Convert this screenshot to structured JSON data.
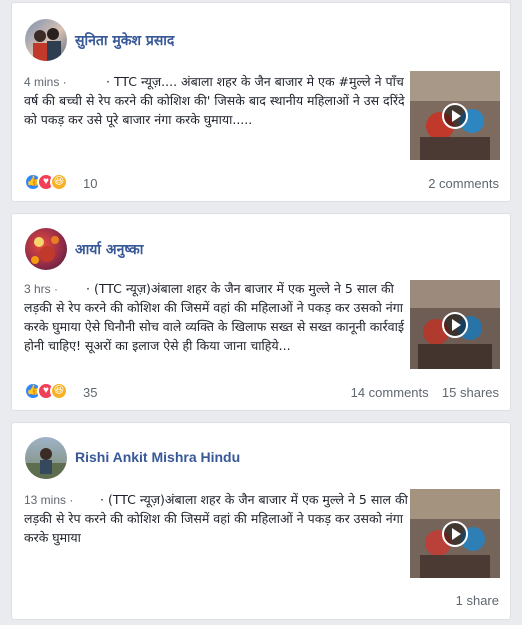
{
  "posts": [
    {
      "author": "सुनिता मुकेश प्रसाद",
      "time": "4 mins ·",
      "text": "· TTC न्यूज़.... अंबाला शहर के जैन बाजार मे एक #मुल्ले ने पाँच वर्ष की बच्ची से रेप करने की कोशिश की' जिसके बाद स्थानीय महिलाओं ने उस दरिंदे को पकड़ कर उसे पूरे बाजार नंगा करके घुमाया.....",
      "reactions_count": "10",
      "comments": "2 comments",
      "shares": ""
    },
    {
      "author": "आर्या अनुष्का",
      "time": "3 hrs ·",
      "text": "· (TTC न्यूज़)अंबाला शहर के जैन बाजार में एक मुल्ले ने 5 साल की लड़की से रेप करने की कोशिश की जिसमें वहां की महिलाओं ने पकड़ कर उसको नंगा करके घुमाया ऐसे घिनौनी सोच वाले व्यक्ति के खिलाफ सख्त से सख्त कानूनी कार्रवाई होनी चाहिए! सूअरों का इलाज ऐसे ही किया जाना चाहिये...",
      "reactions_count": "35",
      "comments": "14 comments",
      "shares": "15 shares"
    },
    {
      "author": "Rishi Ankit Mishra Hindu",
      "time": "13 mins ·",
      "text": "· (TTC न्यूज़)अंबाला शहर के जैन बाजार में एक मुल्ले ने 5 साल की लड़की से रेप करने की कोशिश की जिसमें वहां की महिलाओं ने पकड़ कर उसको नंगा करके घुमाया",
      "reactions_count": "",
      "comments": "",
      "shares": "1 share"
    }
  ],
  "colors": {
    "author": "#385898",
    "like": "#2d88ff",
    "love": "#f33e58",
    "haha": "#f7b125"
  },
  "icons": {
    "globe": "globe-icon",
    "play": "play-icon"
  }
}
